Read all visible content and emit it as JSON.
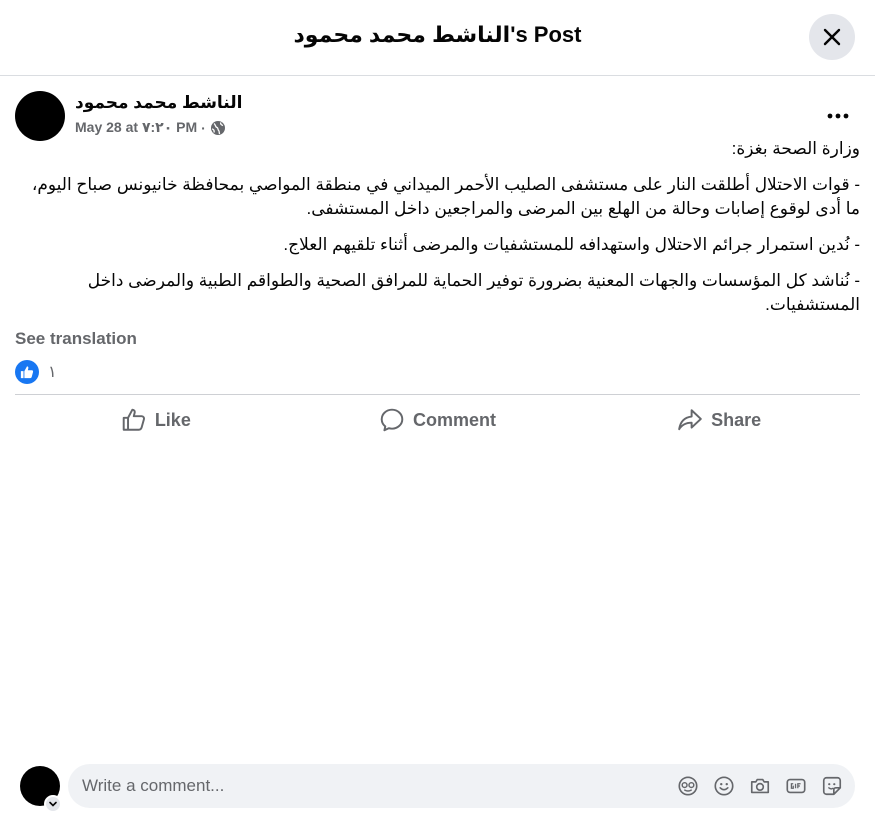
{
  "dialog": {
    "title": "الناشط محمد محمود's Post"
  },
  "post": {
    "author": "الناشط محمد محمود",
    "timestamp": "May 28 at ٧:٢٠ PM",
    "separator": "·",
    "audience_icon": "globe-icon",
    "paragraphs": [
      "وزارة الصحة بغزة:",
      "- قوات الاحتلال أطلقت النار على مستشفى الصليب الأحمر الميداني في منطقة المواصي بمحافظة خانيونس صباح اليوم، ما أدى لوقوع إصابات وحالة من الهلع بين المرضى والمراجعين داخل المستشفى.",
      "- نُدين استمرار جرائم الاحتلال واستهدافه للمستشفيات والمرضى أثناء تلقيهم العلاج.",
      "- نُناشد كل المؤسسات والجهات المعنية بضرورة توفير الحماية للمرافق الصحية والطواقم الطبية والمرضى داخل المستشفيات."
    ],
    "see_translation": "See translation",
    "reaction_count": "١"
  },
  "actions": {
    "like": "Like",
    "comment": "Comment",
    "share": "Share"
  },
  "composer": {
    "placeholder": "Write a comment...",
    "icons": [
      "avatar-sticker-icon",
      "emoji-icon",
      "camera-icon",
      "gif-icon",
      "sticker-icon"
    ]
  },
  "colors": {
    "accent": "#1877f2",
    "secondary_text": "#65676b",
    "button_bg": "#e4e6eb",
    "input_bg": "#f0f2f5"
  }
}
